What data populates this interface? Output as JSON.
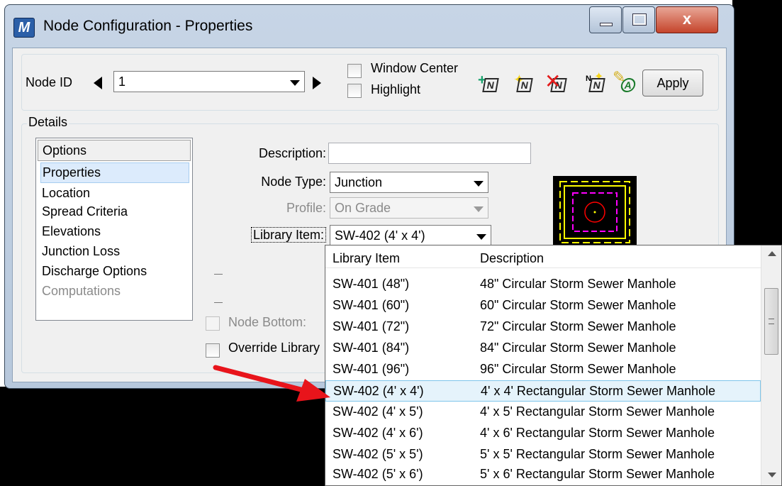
{
  "window": {
    "title": "Node Configuration - Properties",
    "app_icon": "microstation-logo-icon"
  },
  "toolbar": {
    "node_id_label": "Node ID",
    "node_id_value": "1",
    "window_center_label": "Window Center",
    "highlight_label": "Highlight",
    "apply_label": "Apply",
    "icons": [
      "add-node-icon",
      "highlight-node-icon",
      "delete-node-icon",
      "label-node-icon",
      "annotate-node-icon"
    ]
  },
  "details": {
    "legend": "Details",
    "options_header": "Options",
    "options": [
      {
        "label": "Properties",
        "selected": true
      },
      {
        "label": "Location"
      },
      {
        "label": "Spread Criteria"
      },
      {
        "label": "Elevations"
      },
      {
        "label": "Junction Loss"
      },
      {
        "label": "Discharge Options"
      },
      {
        "label": "Computations",
        "disabled": true
      }
    ],
    "description_label": "Description:",
    "description_value": "",
    "node_type_label": "Node Type:",
    "node_type_value": "Junction",
    "profile_label": "Profile:",
    "profile_value": "On Grade",
    "library_item_label": "Library Item:",
    "library_item_value": "SW-402 (4' x 4')",
    "node_bottom_label": "Node Bottom:",
    "override_label": "Override Library"
  },
  "library_dropdown": {
    "columns": [
      "Library Item",
      "Description"
    ],
    "rows": [
      {
        "item": "SW-401 (48\")",
        "description": "48\" Circular Storm Sewer Manhole"
      },
      {
        "item": "SW-401 (60\")",
        "description": "60\" Circular Storm Sewer Manhole"
      },
      {
        "item": "SW-401 (72\")",
        "description": "72\" Circular Storm Sewer Manhole"
      },
      {
        "item": "SW-401 (84\")",
        "description": "84\" Circular Storm Sewer Manhole"
      },
      {
        "item": "SW-401 (96\")",
        "description": "96\" Circular Storm Sewer Manhole"
      },
      {
        "item": "SW-402 (4' x 4')",
        "description": "4' x 4' Rectangular Storm Sewer Manhole",
        "selected": true
      },
      {
        "item": "SW-402 (4' x 5')",
        "description": "4' x 5' Rectangular Storm Sewer Manhole"
      },
      {
        "item": "SW-402 (4' x 6')",
        "description": "4' x 6' Rectangular Storm Sewer Manhole"
      },
      {
        "item": "SW-402 (5' x 5')",
        "description": "5' x 5' Rectangular Storm Sewer Manhole"
      },
      {
        "item": "SW-402 (5' x 6')",
        "description": "5' x 6' Rectangular Storm Sewer Manhole"
      }
    ]
  },
  "colors": {
    "accent": "#7fc5ea",
    "callout": "#e8141b",
    "preview_outer": "#ffff00",
    "preview_inner": "#ff00ff",
    "preview_circle": "#ff0000"
  }
}
